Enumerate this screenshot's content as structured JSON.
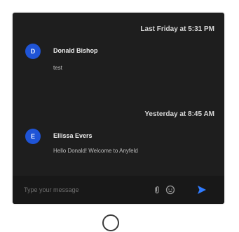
{
  "colors": {
    "panel_background": "#1e1e1e",
    "avatar_color": "#1f54d6",
    "accent_blue": "#2f7bff"
  },
  "messages": [
    {
      "timestamp": "Last Friday at 5:31 PM",
      "avatar_initial": "D",
      "author": "Donald Bishop",
      "text": "test"
    },
    {
      "timestamp": "Yesterday at 8:45 AM",
      "avatar_initial": "E",
      "author": "Ellissa Evers",
      "text": "Hello Donald! Welcome to Anyfeld"
    }
  ],
  "composer": {
    "placeholder": "Type your message",
    "attach_icon": "paperclip-icon",
    "emoji_icon": "emoji-icon",
    "send_icon": "send-icon"
  }
}
